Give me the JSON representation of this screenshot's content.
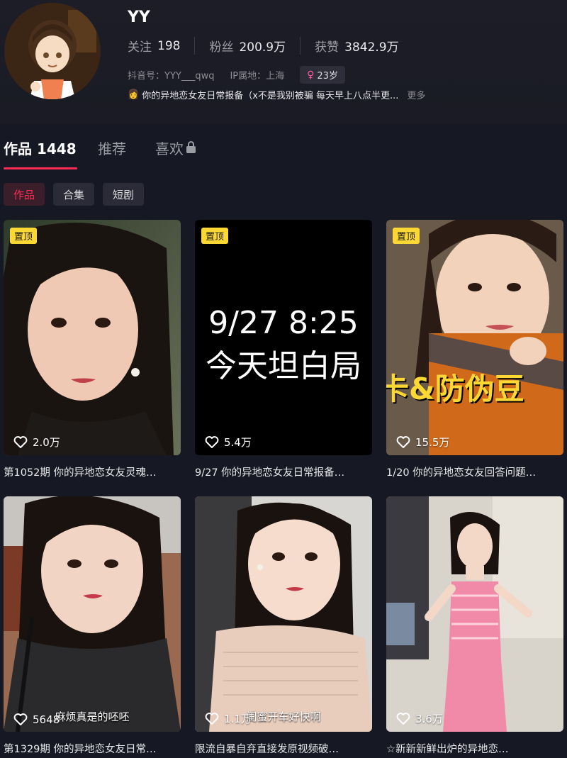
{
  "profile": {
    "name": "YY",
    "stats": [
      {
        "label": "关注",
        "value": "198"
      },
      {
        "label": "粉丝",
        "value": "200.9万"
      },
      {
        "label": "获赞",
        "value": "3842.9万"
      }
    ],
    "douyin_id": "抖音号：YYY___qwq",
    "ip_location": "IP属地：上海",
    "age": "23岁",
    "bio_icon": "👩",
    "bio": "你的异地恋女友日常报备（x不是我别被骗 每天早上八点半更...",
    "bio_more": "更多"
  },
  "tabs": [
    {
      "label": "作品 1448"
    },
    {
      "label": "推荐"
    },
    {
      "label": "喜欢"
    }
  ],
  "filters": [
    {
      "label": "作品"
    },
    {
      "label": "合集"
    },
    {
      "label": "短剧"
    }
  ],
  "videos": [
    {
      "pinned": "置顶",
      "likes": "2.0万",
      "caption": "第1052期 你的异地恋女友灵魂…"
    },
    {
      "pinned": "置顶",
      "likes": "5.4万",
      "caption": "9/27 你的异地恋女友日常报备…",
      "overlay_line1": "9/27 8:25",
      "overlay_line2": "今天坦白局"
    },
    {
      "pinned": "置顶",
      "likes": "15.5万",
      "caption": "1/20 你的异地恋女友回答问题…",
      "overlay_text": "卡&防伪豆"
    },
    {
      "likes": "5648",
      "caption": "第1329期 你的异地恋女友日常…",
      "subtitle": "麻烦真是的呸呸"
    },
    {
      "likes": "1.1万",
      "caption": "限流自暴自弃直接发原视频破…",
      "subtitle": "闺蜜开车好快啊"
    },
    {
      "likes": "3.6万",
      "caption": "☆新新新鲜出炉的异地恋…"
    }
  ],
  "colors": {
    "accent": "#fe2c55",
    "pin": "#fdd835",
    "background": "#161823"
  }
}
